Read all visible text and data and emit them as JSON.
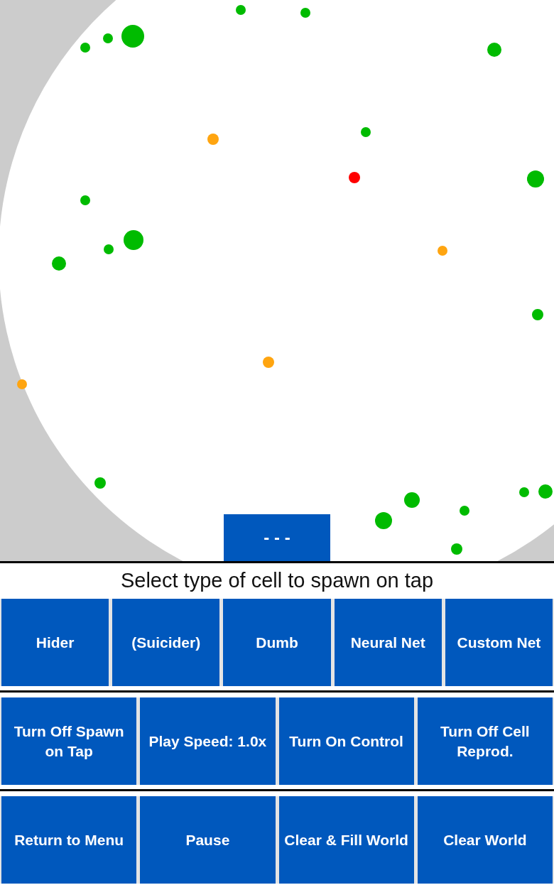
{
  "world": {
    "cells": [
      {
        "color": "#00bb00"
      },
      {
        "color": "#00bb00"
      },
      {
        "color": "#00bb00"
      },
      {
        "color": "#00bb00"
      },
      {
        "color": "#00bb00"
      },
      {
        "color": "#00bb00"
      },
      {
        "color": "#ffa510"
      },
      {
        "color": "#00bb00"
      },
      {
        "color": "#ff0000"
      },
      {
        "color": "#00bb00"
      },
      {
        "color": "#00bb00"
      },
      {
        "color": "#00bb00"
      },
      {
        "color": "#00bb00"
      },
      {
        "color": "#00bb00"
      },
      {
        "color": "#ffa510"
      },
      {
        "color": "#00bb00"
      },
      {
        "color": "#ffa510"
      },
      {
        "color": "#ffa510"
      },
      {
        "color": "#00bb00"
      },
      {
        "color": "#00bb00"
      },
      {
        "color": "#00bb00"
      },
      {
        "color": "#00bb00"
      },
      {
        "color": "#00bb00"
      },
      {
        "color": "#00bb00"
      },
      {
        "color": "#00bb00"
      }
    ],
    "overlay_button": {
      "label": "- - -"
    }
  },
  "spawn_panel": {
    "title": "Select type of cell to spawn on tap",
    "cell_types": [
      {
        "label": "Hider"
      },
      {
        "label": "(Suicider)"
      },
      {
        "label": "Dumb"
      },
      {
        "label": "Neural Net"
      },
      {
        "label": "Custom Net"
      }
    ]
  },
  "controls": [
    {
      "label": "Turn Off Spawn on Tap"
    },
    {
      "label": "Play Speed: 1.0x"
    },
    {
      "label": "Turn On Control"
    },
    {
      "label": "Turn Off Cell Reprod."
    }
  ],
  "actions": [
    {
      "label": "Return to Menu"
    },
    {
      "label": "Pause"
    },
    {
      "label": "Clear & Fill World"
    },
    {
      "label": "Clear World"
    }
  ]
}
